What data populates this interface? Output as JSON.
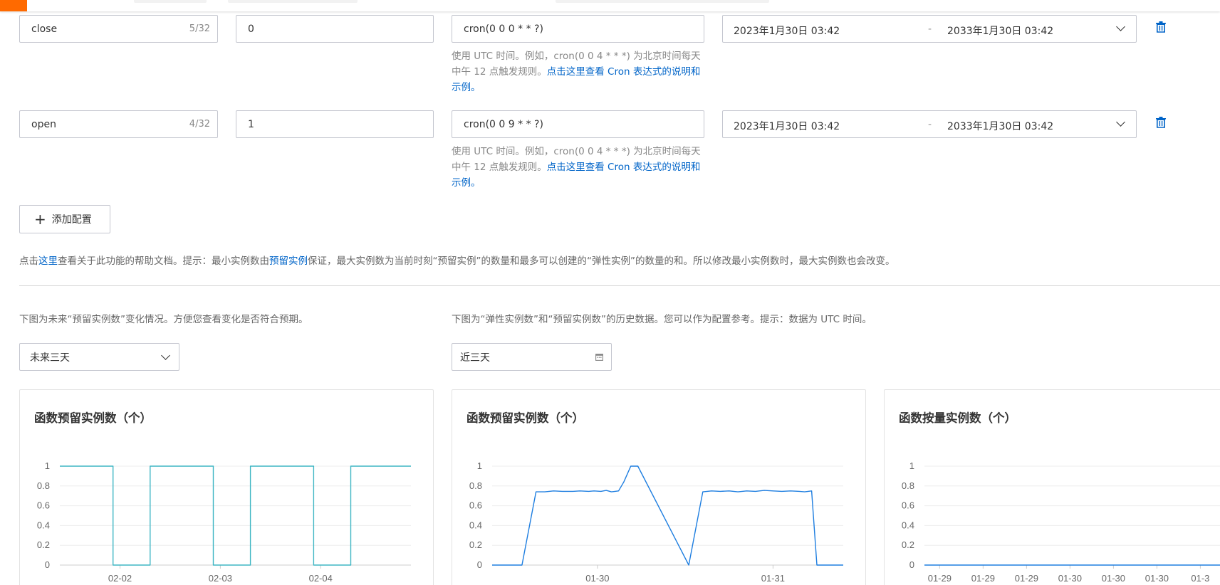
{
  "rows": [
    {
      "name": "close",
      "count": "5/32",
      "value": "0",
      "cron": "cron(0 0 0 * * ?)",
      "start": "2023年1月30日 03:42",
      "sep": "-",
      "end": "2033年1月30日 03:42"
    },
    {
      "name": "open",
      "count": "4/32",
      "value": "1",
      "cron": "cron(0 0 9 * * ?)",
      "start": "2023年1月30日 03:42",
      "sep": "-",
      "end": "2033年1月30日 03:42"
    }
  ],
  "cron_hint": {
    "text": "使用 UTC 时间。例如，cron(0 0 4 * * *) 为北京时间每天中午 12 点触发规则。",
    "link": "点击这里查看 Cron 表达式的说明和示例。"
  },
  "add_button": {
    "icon": "plus-icon",
    "label": "添加配置"
  },
  "help": {
    "prefix": "点击",
    "link1": "这里",
    "middle": "查看关于此功能的帮助文档。提示：最小实例数由",
    "link2": "预留实例",
    "suffix": "保证，最大实例数为当前时刻“预留实例”的数量和最多可以创建的“弹性实例”的数量的和。所以修改最小实例数时，最大实例数也会改变。"
  },
  "desc_left": "下图为未来“预留实例数”变化情况。方便您查看变化是否符合预期。",
  "desc_right": "下图为“弹性实例数”和“预留实例数”的历史数据。您可以作为配置参考。提示：数据为 UTC 时间。",
  "future_select": "未来三天",
  "history_select": "近三天",
  "colors": {
    "accent": "#ff6a00",
    "link": "#0064c8",
    "teal_line": "#3fb6c4",
    "blue_line": "#1e7ee0"
  },
  "chart_data": [
    {
      "type": "line",
      "title": "函数预留实例数（个）",
      "ylim": [
        0,
        1
      ],
      "yticks": [
        "1",
        "0.8",
        "0.6",
        "0.4",
        "0.2",
        "0"
      ],
      "x_tick_labels": [
        "02-02",
        "02-03",
        "02-04"
      ],
      "x_tick_positions": [
        1,
        2,
        3
      ],
      "xlim": [
        0.4,
        3.9
      ],
      "grid": true,
      "series": [
        {
          "x": [
            0.4,
            0.93,
            0.93,
            1.3,
            1.3,
            1.93,
            1.93,
            2.3,
            2.3,
            2.93,
            2.93,
            3.3,
            3.3,
            3.9
          ],
          "values": [
            1,
            1,
            0,
            0,
            1,
            1,
            0,
            0,
            1,
            1,
            0,
            0,
            1,
            1
          ],
          "color": "#3fb6c4"
        }
      ]
    },
    {
      "type": "line",
      "title": "函数预留实例数（个）",
      "ylim": [
        0,
        1
      ],
      "yticks": [
        "1",
        "0.8",
        "0.6",
        "0.4",
        "0.2",
        "0"
      ],
      "x_tick_labels": [
        "01-30",
        "01-31"
      ],
      "x_tick_positions": [
        1,
        2
      ],
      "xlim": [
        0.4,
        2.4
      ],
      "grid": true,
      "series": [
        {
          "x": [
            0.4,
            0.57,
            0.65,
            0.7,
            0.75,
            0.8,
            0.86,
            0.9,
            0.95,
            0.98,
            1.02,
            1.05,
            1.08,
            1.12,
            1.15,
            1.19,
            1.23,
            1.52,
            1.6,
            1.65,
            1.7,
            1.75,
            1.8,
            1.85,
            1.9,
            1.95,
            2.0,
            2.05,
            2.1,
            2.15,
            2.18,
            2.22,
            2.25,
            2.28,
            2.4
          ],
          "values": [
            0,
            0,
            0.74,
            0.74,
            0.75,
            0.745,
            0.745,
            0.75,
            0.745,
            0.75,
            0.745,
            0.755,
            0.74,
            0.75,
            0.84,
            1,
            1,
            0,
            0.74,
            0.75,
            0.745,
            0.75,
            0.74,
            0.75,
            0.745,
            0.755,
            0.75,
            0.745,
            0.75,
            0.745,
            0.74,
            0.75,
            0,
            0,
            0
          ],
          "color": "#1e7ee0"
        }
      ]
    },
    {
      "type": "line",
      "title": "函数按量实例数（个）",
      "ylim": [
        0,
        1
      ],
      "yticks": [
        "1",
        "0.8",
        "0.6",
        "0.4",
        "0.2",
        "0"
      ],
      "x_tick_labels": [
        "01-29",
        "01-29",
        "01-29",
        "01-30",
        "01-30",
        "01-30",
        "01-3"
      ],
      "x_tick_positions": [
        1,
        2,
        3,
        4,
        5,
        6,
        7
      ],
      "xlim": [
        0.65,
        7.6
      ],
      "grid": true,
      "series": [
        {
          "x": [
            0.65,
            7.6
          ],
          "values": [
            0,
            0
          ],
          "color": "#1e7ee0"
        }
      ]
    }
  ]
}
